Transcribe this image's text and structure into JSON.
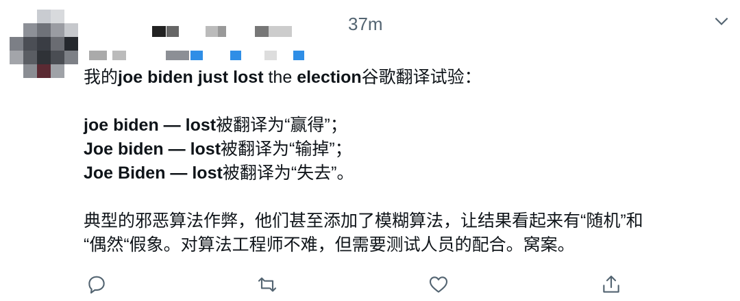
{
  "header": {
    "timestamp": "37m"
  },
  "tweet": {
    "line1_pre": "我的",
    "line1_bold1": "joe biden just lost",
    "line1_mid": " the ",
    "line1_bold2": "election",
    "line1_post": "谷歌翻译试验：",
    "line3_bold": "joe biden — lost",
    "line3_rest": "被翻译为“赢得”；",
    "line4_bold": "Joe biden — lost",
    "line4_rest": "被翻译为“输掉”；",
    "line5_bold": "Joe Biden — lost",
    "line5_rest": "被翻译为“失去”。",
    "para2_line1": "典型的邪恶算法作弊，他们甚至添加了模糊算法，让结果看起来有“随机”和",
    "para2_line2": "“偶然“假象。对算法工程师不难，但需要测试人员的配合。窝案。"
  },
  "actions": {
    "reply": "reply-icon",
    "retweet": "retweet-icon",
    "like": "heart-icon",
    "share": "share-icon"
  },
  "colors": {
    "icon": "#536471",
    "text": "#0f1419"
  }
}
